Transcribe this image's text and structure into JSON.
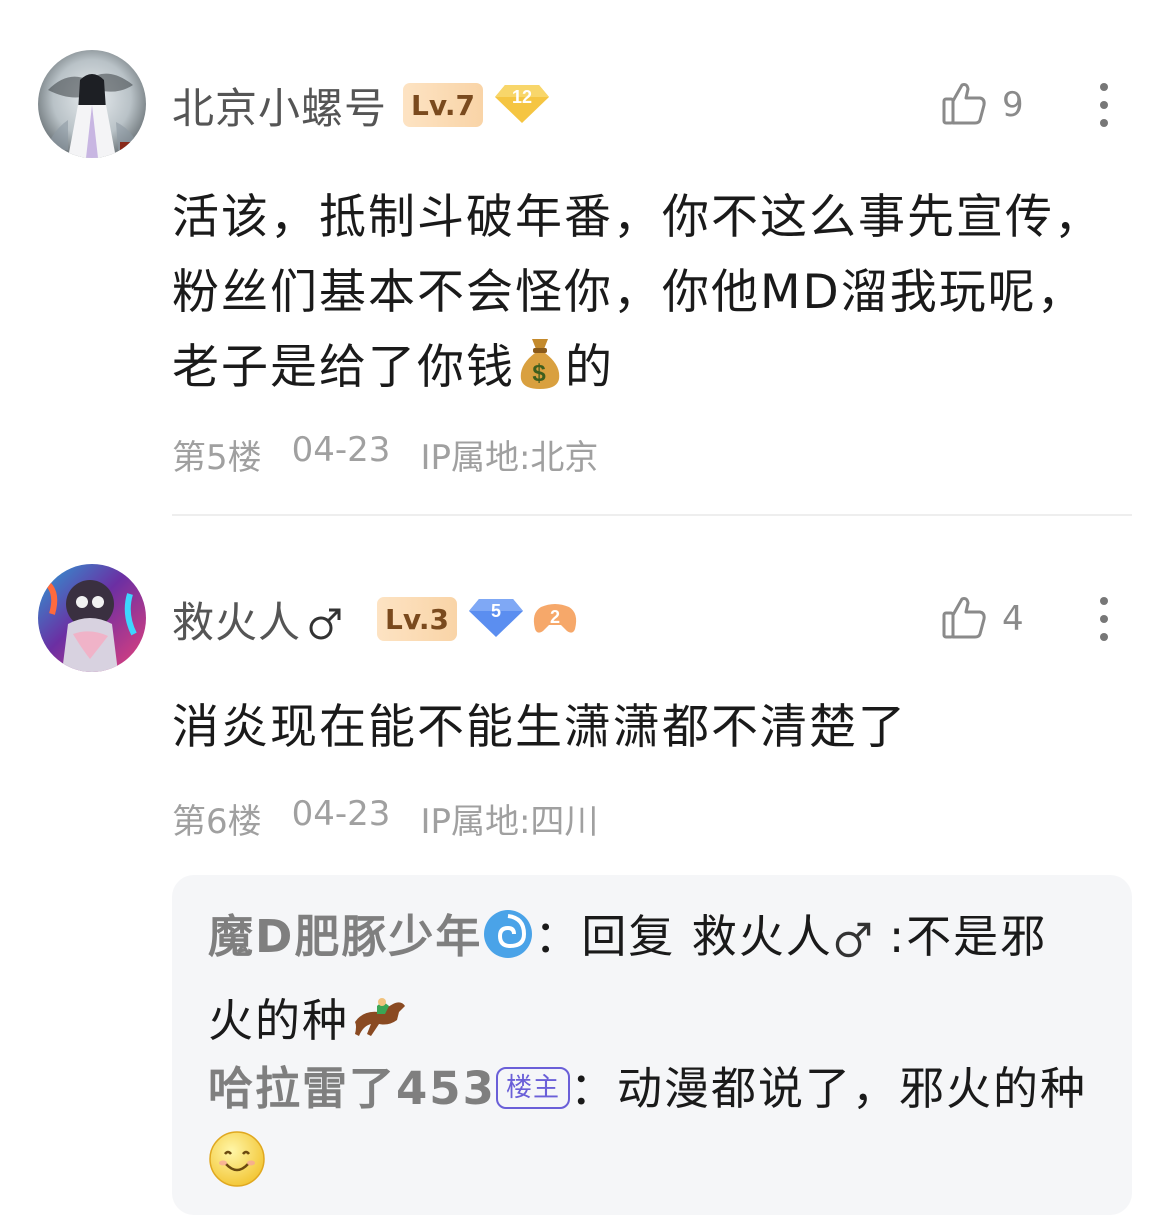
{
  "comments": [
    {
      "username": "北京小螺号",
      "level": "Lv.7",
      "diamond_level": "12",
      "likes": "9",
      "text_before_emoji": "活该，抵制斗破年番，你不这么事先宣传，粉丝们基本不会怪你，你他MD溜我玩呢，老子是给了你钱",
      "text_after_emoji": "的",
      "emoji_icon": "money-bag-icon",
      "floor": "第5楼",
      "date": "04-23",
      "ip": "IP属地:北京"
    },
    {
      "username": "救火人",
      "gender_icon": "male-icon",
      "level": "Lv.3",
      "diamond_level": "5",
      "game_badge_level": "2",
      "likes": "4",
      "text": "消炎现在能不能生潇潇都不清楚了",
      "floor": "第6楼",
      "date": "04-23",
      "ip": "IP属地:四川",
      "replies": [
        {
          "author": "魔D肥豚少年",
          "author_emoji": "cyclone-icon",
          "separator": "：",
          "reply_prefix": "回复 ",
          "reply_to": "救火人",
          "reply_to_icon": "male-icon",
          "text": " :不是邪火的种",
          "trailing_emoji": "horse-racing-icon"
        },
        {
          "author": "哈拉雷了453",
          "owner_tag": "楼主",
          "separator": "：",
          "text": "动漫都说了，邪火的种",
          "trailing_emoji": "smiley-icon"
        }
      ]
    }
  ],
  "colors": {
    "level_badge_bg": "#f9d4a7",
    "level_badge_text": "#7a4a1e",
    "diamond_gold": "#f5c542",
    "diamond_blue": "#5b8ef0",
    "owner_tag": "#6a5fd8",
    "meta_text": "#a0a0a0",
    "reply_bg": "#f5f6f8"
  }
}
